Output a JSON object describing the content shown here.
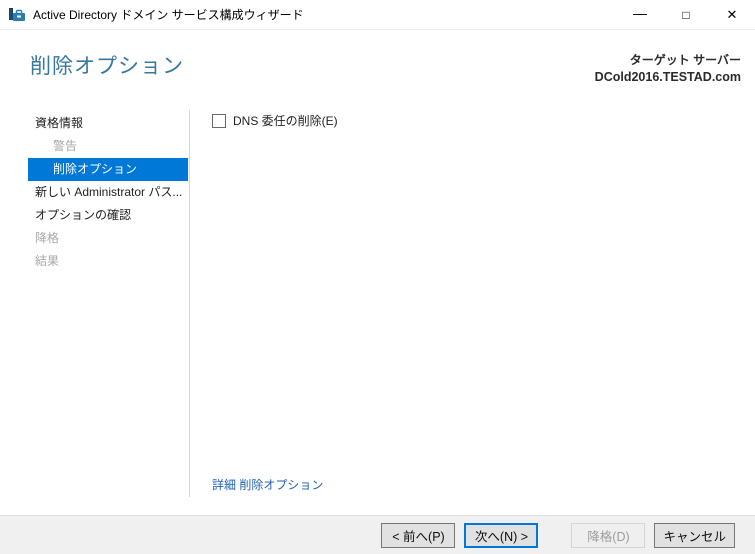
{
  "window": {
    "title": "Active Directory ドメイン サービス構成ウィザード",
    "controls": {
      "minimize_glyph": "—",
      "maximize_glyph": "□",
      "close_glyph": "✕"
    }
  },
  "header": {
    "page_title": "削除オプション",
    "target_server_label": "ターゲット サーバー",
    "target_server_name": "DCold2016.TESTAD.com"
  },
  "sidebar": {
    "items": [
      {
        "label": "資格情報",
        "level": 0,
        "state": "enabled"
      },
      {
        "label": "警告",
        "level": 1,
        "state": "disabled"
      },
      {
        "label": "削除オプション",
        "level": 1,
        "state": "selected"
      },
      {
        "label": "新しい Administrator パス...",
        "level": 0,
        "state": "enabled"
      },
      {
        "label": "オプションの確認",
        "level": 0,
        "state": "enabled"
      },
      {
        "label": "降格",
        "level": 0,
        "state": "disabled"
      },
      {
        "label": "結果",
        "level": 0,
        "state": "disabled"
      }
    ]
  },
  "content": {
    "checkbox_label": "DNS 委任の削除(E)",
    "checkbox_checked": false,
    "advanced_link": "詳細 削除オプション"
  },
  "footer": {
    "buttons": [
      {
        "label": "< 前へ(P)",
        "state": "normal"
      },
      {
        "label": "次へ(N) >",
        "state": "default"
      },
      {
        "label": "降格(D)",
        "state": "disabled"
      },
      {
        "label": "キャンセル",
        "state": "normal"
      }
    ]
  },
  "colors": {
    "accent": "#0078d7",
    "heading": "#3878a0",
    "link": "#2162b0",
    "footer_bg": "#f0f0f0"
  }
}
